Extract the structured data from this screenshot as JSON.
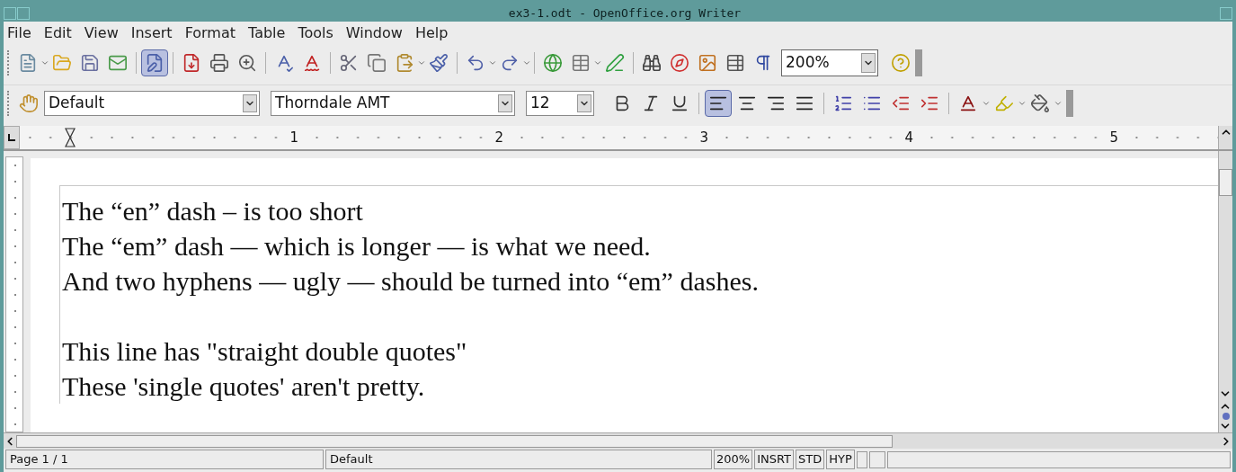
{
  "window": {
    "title": "ex3-1.odt - OpenOffice.org Writer"
  },
  "menu": [
    "File",
    "Edit",
    "View",
    "Insert",
    "Format",
    "Table",
    "Tools",
    "Window",
    "Help"
  ],
  "standard_toolbar": {
    "edit_mode": {
      "selected": true
    },
    "zoom": "200%"
  },
  "formatting_toolbar": {
    "style": "Default",
    "font": "Thorndale AMT",
    "size": "12",
    "alignment": [
      {
        "selected": true
      },
      {
        "selected": false
      },
      {
        "selected": false
      },
      {
        "selected": false
      }
    ]
  },
  "ruler": {
    "labels": [
      "1",
      "2",
      "3",
      "4",
      "5"
    ]
  },
  "document": {
    "blocks": [
      {
        "lines": [
          "The “en” dash – is too short",
          "The “em” dash — which is longer — is what we need.",
          "And two hyphens — ugly — should be turned into “em” dashes."
        ]
      },
      {
        "lines": [
          "This line has \"straight double quotes\"",
          "These 'single quotes' aren't pretty."
        ]
      }
    ]
  },
  "status_bar": {
    "page": "Page 1 / 1",
    "style": "Default",
    "zoom": "200%",
    "mode": "INSRT",
    "selection": "STD",
    "hyphenation": "HYP"
  }
}
